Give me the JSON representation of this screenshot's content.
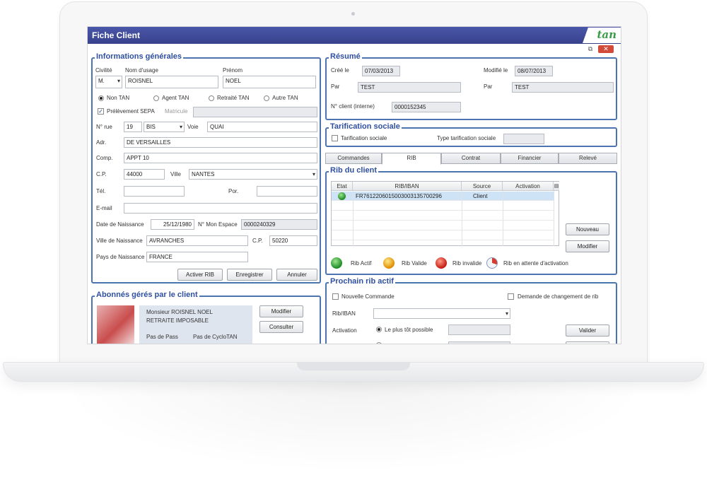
{
  "window": {
    "title": "Fiche Client",
    "logo": "tan"
  },
  "infos": {
    "legend": "Informations générales",
    "civilite_label": "Civilité",
    "civilite_value": "M.",
    "nom_label": "Nom d'usage",
    "nom_value": "ROISNEL",
    "prenom_label": "Prénom",
    "prenom_value": "NOEL",
    "statuts": [
      "Non TAN",
      "Agent TAN",
      "Retraité TAN",
      "Autre TAN"
    ],
    "statut_selected": "Non TAN",
    "prelevement_label": "Prélèvement SEPA",
    "prelevement_checked": true,
    "matricule_label": "Matricule",
    "matricule_value": "",
    "num_rue_label": "N° rue",
    "num_rue_value": "19",
    "bis_value": "BIS",
    "voie_label": "Voie",
    "voie_value": "QUAI",
    "adr_label": "Adr.",
    "adr_value": "DE VERSAILLES",
    "comp_label": "Comp.",
    "comp_value": "APPT 10",
    "cp_label": "C.P.",
    "cp_value": "44000",
    "ville_label": "Ville",
    "ville_value": "NANTES",
    "tel_label": "Tél.",
    "tel_value": "",
    "por_label": "Por.",
    "por_value": "",
    "email_label": "E-mail",
    "email_value": "",
    "naissance_label": "Date de Naissance",
    "naissance_value": "25/12/1980",
    "mon_espace_label": "N° Mon Espace",
    "mon_espace_value": "0000240329",
    "ville_naissance_label": "Ville de Naissance",
    "ville_naissance_value": "AVRANCHES",
    "cp_naissance_label": "C.P.",
    "cp_naissance_value": "50220",
    "pays_naissance_label": "Pays de Naissance",
    "pays_naissance_value": "FRANCE",
    "btn_activer": "Activer RIB",
    "btn_enregistrer": "Enregistrer",
    "btn_annuler": "Annuler"
  },
  "abonnes": {
    "legend": "Abonnés gérés par le client",
    "name": "Monsieur ROISNEL NOEL",
    "status": "RETRAITE IMPOSABLE",
    "pass": "Pas de Pass",
    "cyclotan": "Pas de CycloTAN",
    "btn_modifier": "Modifier",
    "btn_consulter": "Consulter"
  },
  "resume": {
    "legend": "Résumé",
    "cree_label": "Créé le",
    "cree_value": "07/03/2013",
    "modifie_label": "Modifié le",
    "modifie_value": "08/07/2013",
    "par1_label": "Par",
    "par1_value": "TEST",
    "par2_label": "Par",
    "par2_value": "TEST",
    "client_label": "N° client (interne)",
    "client_value": "0000152345"
  },
  "tarification": {
    "legend": "Tarification sociale",
    "check_label": "Tarification sociale",
    "type_label": "Type tarification sociale",
    "type_value": ""
  },
  "tabs": [
    "Commandes",
    "RIB",
    "Contrat",
    "Financier",
    "Relevé"
  ],
  "active_tab": "RIB",
  "rib": {
    "legend": "Rib du client",
    "columns": [
      "Etat",
      "RIB/IBAN",
      "Source",
      "Activation"
    ],
    "rows": [
      {
        "etat": "green",
        "iban": "FR7612206015003003135700296",
        "source": "Client",
        "activation": ""
      }
    ],
    "btn_nouveau": "Nouveau",
    "btn_modifier": "Modifier",
    "legend_items": [
      {
        "color": "green",
        "label": "Rib Actif"
      },
      {
        "color": "yellow",
        "label": "Rib Valide"
      },
      {
        "color": "red",
        "label": "Rib invalide"
      },
      {
        "color": "pending",
        "label": "Rib en attente d'activation"
      }
    ]
  },
  "prochain": {
    "legend": "Prochain rib actif",
    "nouvelle_label": "Nouvelle Commande",
    "demande_label": "Demande de changement de rib",
    "ribiban_label": "Rib/IBAN",
    "ribiban_value": "",
    "activation_label": "Activation",
    "option1": "Le plus tôt possible",
    "option2": "",
    "btn_valider": "Valider",
    "btn_second": ""
  }
}
